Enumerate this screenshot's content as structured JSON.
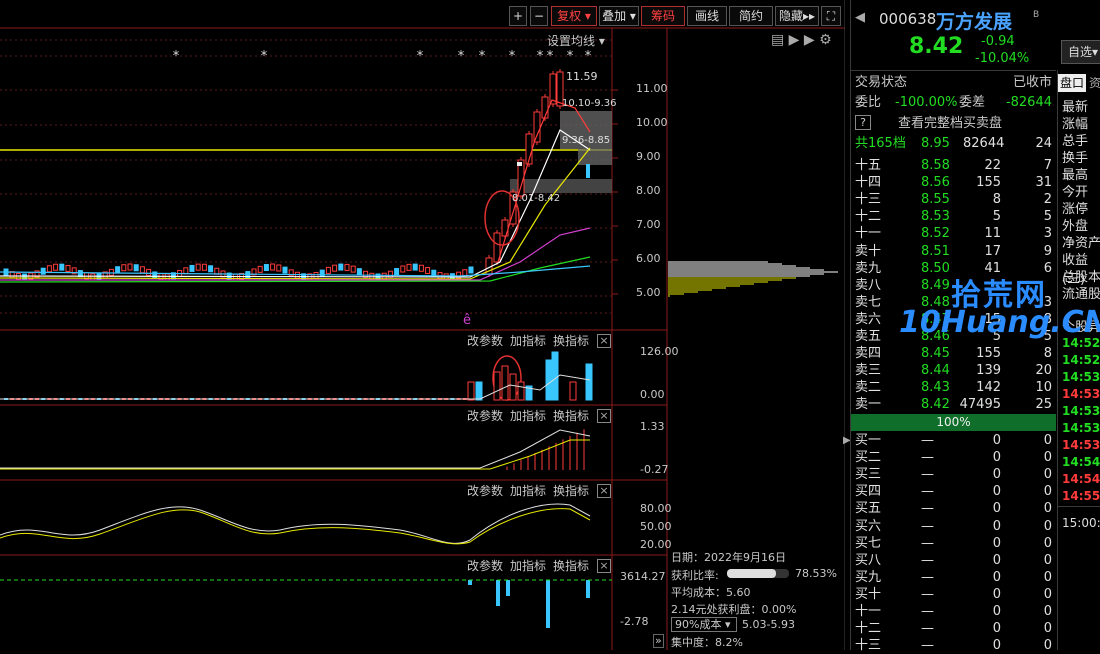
{
  "toolbar": {
    "plus": "+",
    "minus": "−",
    "fq": "复权",
    "overlay": "叠加",
    "chips": "筹码",
    "draw": "画线",
    "simple": "简约",
    "hide": "隐藏",
    "hide_icon": "▸▸",
    "expand_icon": "⛶"
  },
  "main": {
    "ma_setting": "设置均线",
    "price_labels": [
      "11.00",
      "10.00",
      "9.00",
      "8.00",
      "7.00",
      "6.00",
      "5.00"
    ],
    "peak": "11.59",
    "ann1": "10.10-9.36",
    "ann2": "9.36-8.85",
    "ann3": "8.01-8.42",
    "marker": "ê"
  },
  "panels": [
    {
      "btns": [
        "改参数",
        "加指标",
        "换指标"
      ],
      "close": "×",
      "labels": [
        "126.00",
        "0.00"
      ]
    },
    {
      "btns": [
        "改参数",
        "加指标",
        "换指标"
      ],
      "close": "×",
      "labels": [
        "1.33",
        "-0.27"
      ]
    },
    {
      "btns": [
        "改参数",
        "加指标",
        "换指标"
      ],
      "close": "×",
      "labels": [
        "80.00",
        "50.00",
        "20.00"
      ]
    },
    {
      "btns": [
        "改参数",
        "加指标",
        "换指标"
      ],
      "close": "×",
      "labels": [
        "3614.27",
        "-2.78"
      ]
    }
  ],
  "chips": {
    "date": "日期：2022年9月16日",
    "profit_label": "获利比率:",
    "profit": "78.53%",
    "profit_level": 78.53,
    "avgcost": "平均成本：5.60",
    "profit_at": "2.14元处获利盘：0.00%",
    "select": "90%成本",
    "range": "5.03-5.93",
    "concentration": "集中度：8.2%",
    "arrow": "»"
  },
  "stock": {
    "code": "000638",
    "name": "万方发展",
    "badge": "B",
    "price": "8.42",
    "change": "-0.94",
    "pct": "-10.04%",
    "fav": "自选"
  },
  "info": {
    "status_label": "交易状态",
    "status": "已收市",
    "ratio_label": "委比",
    "ratio": "-100.00%",
    "diff_label": "委差",
    "diff": "-82644",
    "full_book": "查看完整档买卖盘",
    "q_icon": "?",
    "total_label": "共165档",
    "total_price": "8.95",
    "total_vol": "82644",
    "total_cnt": "24",
    "pct100": "100%"
  },
  "asks": [
    [
      "十五",
      "8.58",
      "22",
      "7"
    ],
    [
      "十四",
      "8.56",
      "155",
      "31"
    ],
    [
      "十三",
      "8.55",
      "8",
      "2"
    ],
    [
      "十二",
      "8.53",
      "5",
      "5"
    ],
    [
      "十一",
      "8.52",
      "11",
      "3"
    ],
    [
      "卖十",
      "8.51",
      "17",
      "9"
    ],
    [
      "卖九",
      "8.50",
      "41",
      "6"
    ],
    [
      "卖八",
      "8.49",
      "",
      ""
    ],
    [
      "卖七",
      "8.48",
      "",
      "3"
    ],
    [
      "卖六",
      "8.47",
      "15",
      "8"
    ],
    [
      "卖五",
      "8.46",
      "5",
      "5"
    ],
    [
      "卖四",
      "8.45",
      "155",
      "8"
    ],
    [
      "卖三",
      "8.44",
      "139",
      "20"
    ],
    [
      "卖二",
      "8.43",
      "142",
      "10"
    ],
    [
      "卖一",
      "8.42",
      "47495",
      "25"
    ]
  ],
  "bids": [
    [
      "买一",
      "—",
      "0",
      "0"
    ],
    [
      "买二",
      "—",
      "0",
      "0"
    ],
    [
      "买三",
      "—",
      "0",
      "0"
    ],
    [
      "买四",
      "—",
      "0",
      "0"
    ],
    [
      "买五",
      "—",
      "0",
      "0"
    ],
    [
      "买六",
      "—",
      "0",
      "0"
    ],
    [
      "买七",
      "—",
      "0",
      "0"
    ],
    [
      "买八",
      "—",
      "0",
      "0"
    ],
    [
      "买九",
      "—",
      "0",
      "0"
    ],
    [
      "买十",
      "—",
      "0",
      "0"
    ],
    [
      "十一",
      "—",
      "0",
      "0"
    ],
    [
      "十二",
      "—",
      "0",
      "0"
    ],
    [
      "十三",
      "—",
      "0",
      "0"
    ]
  ],
  "side": {
    "tab1": "盘口",
    "tab2": "资",
    "labels": [
      "最新",
      "涨幅",
      "总手",
      "换手",
      "最高",
      "今开",
      "涨停",
      "外盘",
      "净资产",
      "收益(三)",
      "总股本",
      "流通股"
    ],
    "detail": "个股异",
    "times": [
      "14:52:",
      "14:52:",
      "14:53:",
      "14:53:",
      "14:53:",
      "14:53:",
      "14:53:",
      "14:54:",
      "14:54:",
      "14:55:"
    ],
    "time_colors": [
      "#22dd22",
      "#22dd22",
      "#22dd22",
      "#ff3b3b",
      "#22dd22",
      "#22dd22",
      "#ff3b3b",
      "#22dd22",
      "#ff3b3b",
      "#ff3b3b"
    ],
    "time_head": "15:00:"
  },
  "watermark": {
    "cn": "拾荒网",
    "en": "10Huang.CN"
  }
}
